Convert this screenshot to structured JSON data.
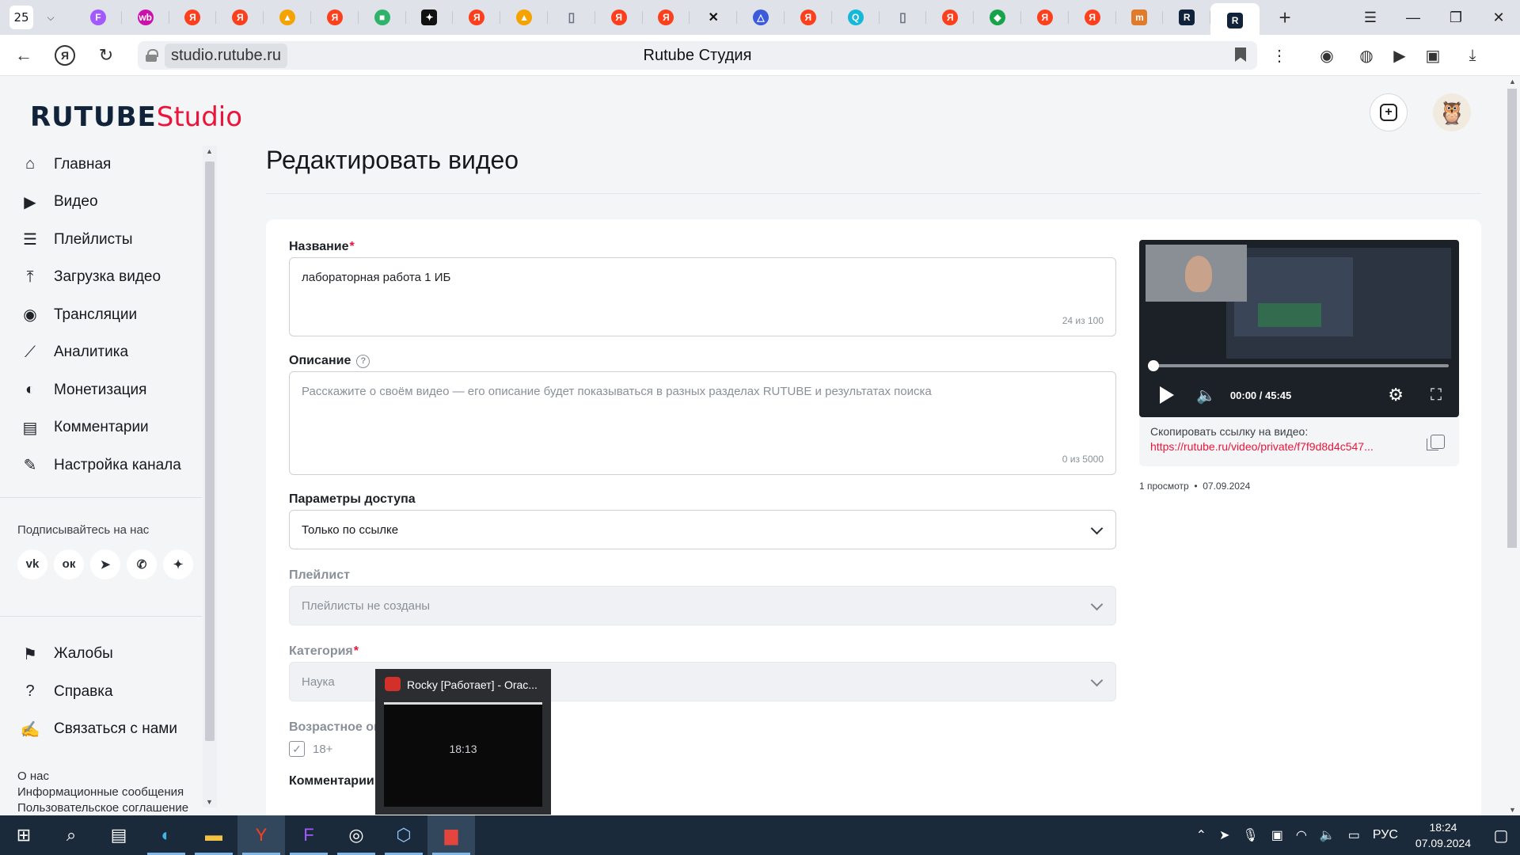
{
  "browser": {
    "tab_count": "25",
    "tabs": [
      {
        "icon": "figma-icon",
        "glyph": "F",
        "color": "#a259ff"
      },
      {
        "icon": "wildberries-icon",
        "glyph": "wb",
        "color": "#cb11ab"
      },
      {
        "icon": "yandex-icon",
        "glyph": "Я",
        "color": "#fc3f1d"
      },
      {
        "icon": "yandex-icon",
        "glyph": "Я",
        "color": "#fc3f1d"
      },
      {
        "icon": "image-icon",
        "glyph": "▲",
        "color": "#f5a300"
      },
      {
        "icon": "yandex-icon",
        "glyph": "Я",
        "color": "#fc3f1d"
      },
      {
        "icon": "robot-icon",
        "glyph": "■",
        "color": "#2fb36b"
      },
      {
        "icon": "sparkle-icon",
        "glyph": "✦",
        "color": "#111111"
      },
      {
        "icon": "yandex-icon",
        "glyph": "Я",
        "color": "#fc3f1d"
      },
      {
        "icon": "image-icon",
        "glyph": "▲",
        "color": "#f5a300"
      },
      {
        "icon": "document-icon",
        "glyph": "▯",
        "color": "#6b7280"
      },
      {
        "icon": "yandex-icon",
        "glyph": "Я",
        "color": "#fc3f1d"
      },
      {
        "icon": "yandex-icon",
        "glyph": "Я",
        "color": "#fc3f1d"
      },
      {
        "icon": "cross-icon",
        "glyph": "✕",
        "color": "#111111"
      },
      {
        "icon": "triangle-icon",
        "glyph": "△",
        "color": "#3b5bdb"
      },
      {
        "icon": "yandex-icon",
        "glyph": "Я",
        "color": "#fc3f1d"
      },
      {
        "icon": "search-icon",
        "glyph": "Q",
        "color": "#14b8d8"
      },
      {
        "icon": "document-icon",
        "glyph": "▯",
        "color": "#6b7280"
      },
      {
        "icon": "yandex-icon",
        "glyph": "Я",
        "color": "#fc3f1d"
      },
      {
        "icon": "leaf-icon",
        "glyph": "◆",
        "color": "#16a34a"
      },
      {
        "icon": "yandex-icon",
        "glyph": "Я",
        "color": "#fc3f1d"
      },
      {
        "icon": "yandex-icon",
        "glyph": "Я",
        "color": "#fc3f1d"
      },
      {
        "icon": "m-icon",
        "glyph": "m",
        "color": "#e07b2b"
      },
      {
        "icon": "rutube-icon",
        "glyph": "R",
        "color": "#10233a"
      },
      {
        "icon": "rutube-icon",
        "glyph": "R",
        "color": "#10233a",
        "active": true
      }
    ],
    "url": "studio.rutube.ru",
    "page_title": "Rutube Студия"
  },
  "app": {
    "logo_main": "RUTUBE",
    "logo_suffix": "Studio",
    "brand_color": "#ed143b",
    "nav": [
      {
        "label": "Главная",
        "icon": "home-icon"
      },
      {
        "label": "Видео",
        "icon": "video-icon"
      },
      {
        "label": "Плейлисты",
        "icon": "playlist-icon"
      },
      {
        "label": "Загрузка видео",
        "icon": "upload-icon"
      },
      {
        "label": "Трансляции",
        "icon": "broadcast-icon"
      },
      {
        "label": "Аналитика",
        "icon": "analytics-icon"
      },
      {
        "label": "Монетизация",
        "icon": "monetization-icon"
      },
      {
        "label": "Комментарии",
        "icon": "comments-icon"
      },
      {
        "label": "Настройка канала",
        "icon": "magic-wand-icon"
      }
    ],
    "follow_title": "Подписывайтесь на нас",
    "socials": [
      {
        "name": "vk-icon",
        "glyph": "vk"
      },
      {
        "name": "odnoklassniki-icon",
        "glyph": "ок"
      },
      {
        "name": "telegram-icon",
        "glyph": "➤"
      },
      {
        "name": "viber-icon",
        "glyph": "✆"
      },
      {
        "name": "dzen-icon",
        "glyph": "✦"
      }
    ],
    "bottom_nav": [
      {
        "label": "Жалобы",
        "icon": "flag-icon"
      },
      {
        "label": "Справка",
        "icon": "help-icon"
      },
      {
        "label": "Связаться с нами",
        "icon": "edit-icon"
      }
    ],
    "footer_links": [
      "О нас",
      "Информационные сообщения",
      "Пользовательское соглашение"
    ]
  },
  "editor": {
    "page_title": "Редактировать видео",
    "title_label": "Название",
    "title_value": "лабораторная работа 1 ИБ",
    "title_counter": "24 из 100",
    "description_label": "Описание",
    "description_placeholder": "Расскажите о своём видео — его описание будет показываться в разных  разделах RUTUBE и результатах поиска",
    "description_counter": "0 из 5000",
    "access_label": "Параметры доступа",
    "access_value": "Только по ссылке",
    "playlist_label": "Плейлист",
    "playlist_value": "Плейлисты не созданы",
    "category_label": "Категория",
    "category_value": "Наука",
    "age_label": "Возрастное ог",
    "age_checkbox_label": "18+",
    "comments_label": "Комментарии"
  },
  "video": {
    "time": "00:00 / 45:45",
    "progress": 0,
    "copy_label": "Скопировать ссылку на видео:",
    "copy_link": "https://rutube.ru/video/private/f7f9d8d4c547...",
    "views": "1 просмотр",
    "date": "07.09.2024"
  },
  "taskbar": {
    "preview_title": "Rocky [Работает] - Orac...",
    "preview_clock": "18:13",
    "language": "РУС",
    "time": "18:24",
    "date": "07.09.2024"
  }
}
